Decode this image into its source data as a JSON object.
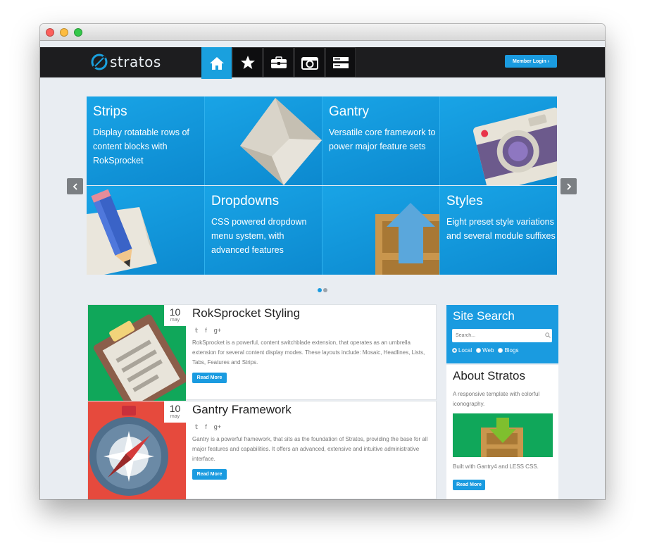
{
  "brand": {
    "logo_text": "stratos"
  },
  "nav": {
    "items": [
      {
        "icon": "home-icon",
        "active": true
      },
      {
        "icon": "star-icon",
        "active": false
      },
      {
        "icon": "briefcase-icon",
        "active": false
      },
      {
        "icon": "camera-icon",
        "active": false
      },
      {
        "icon": "server-icon",
        "active": false
      }
    ],
    "member_login": "Member Login ›"
  },
  "slider": {
    "tiles": [
      {
        "title": "Strips",
        "body": "Display rotatable rows of content blocks with RokSprocket"
      },
      {
        "title": "Gantry",
        "body": "Versatile core framework to power major feature sets"
      },
      {
        "title": "Dropdowns",
        "body": "CSS powered dropdown menu system, with advanced features"
      },
      {
        "title": "Styles",
        "body": "Eight preset style variations and several module suffixes"
      }
    ],
    "page_count": 2,
    "current_page": 1
  },
  "articles": [
    {
      "day": "10",
      "month": "may",
      "title": "RokSprocket Styling",
      "body": "RokSprocket is a powerful, content switchblade extension, that operates as an umbrella extension for several content display modes. These layouts include: Mosaic, Headlines, Lists, Tabs, Features and Strips.",
      "read_more": "Read More",
      "social": [
        "𝕥",
        "f",
        "g+"
      ]
    },
    {
      "day": "10",
      "month": "may",
      "title": "Gantry Framework",
      "body": "Gantry is a powerful framework, that sits as the foundation of Stratos, providing the base for all major features and capabilities. It offers an advanced, extensive and intuitive administrative interface.",
      "read_more": "Read More",
      "social": [
        "𝕥",
        "f",
        "g+"
      ]
    }
  ],
  "site_search": {
    "title": "Site Search",
    "placeholder": "Search...",
    "options": [
      "Local",
      "Web",
      "Blogs"
    ],
    "selected": "Local"
  },
  "about": {
    "title": "About Stratos",
    "text": "A responsive template with colorful iconography.",
    "built": "Built with Gantry4 and LESS CSS.",
    "read_more": "Read More"
  },
  "colors": {
    "accent": "#1a9be0",
    "navbar": "#1d1d1f",
    "page_bg": "#e9edf2"
  }
}
